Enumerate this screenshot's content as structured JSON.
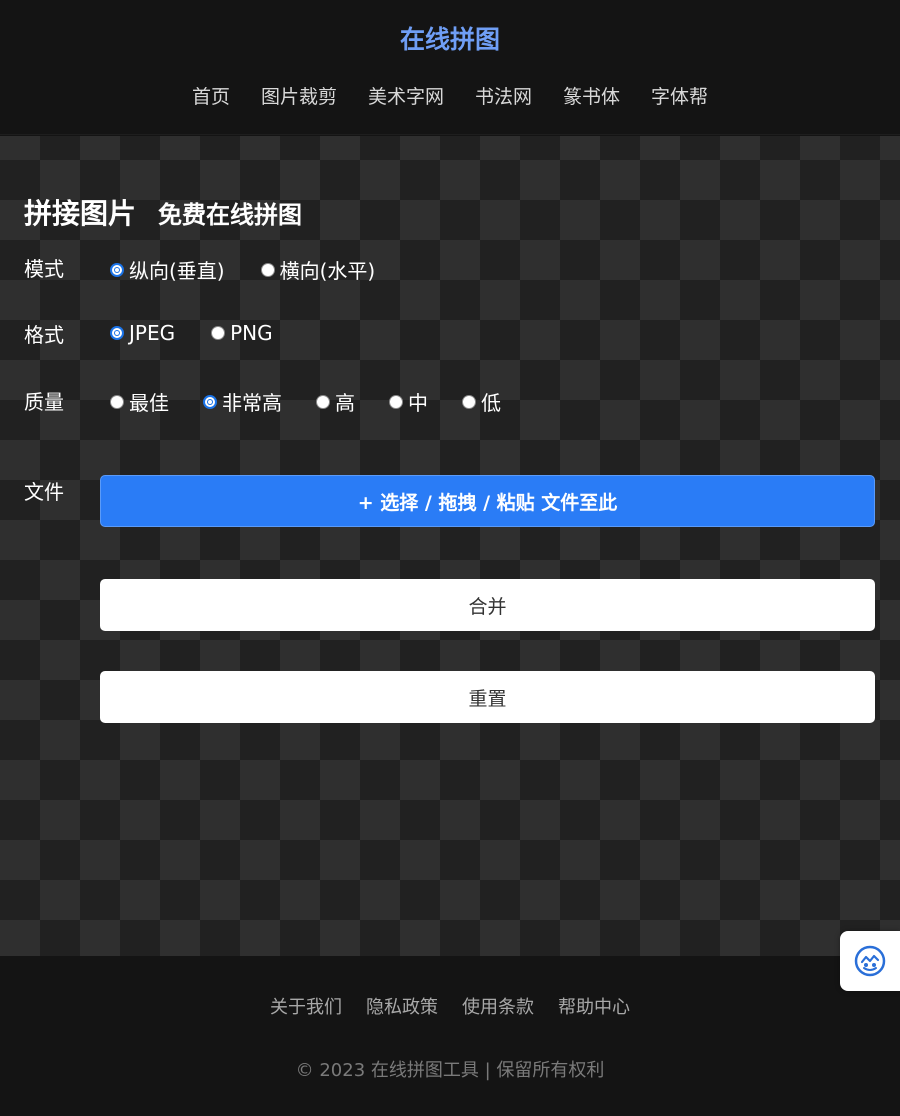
{
  "header": {
    "title": "在线拼图",
    "nav": [
      "首页",
      "图片裁剪",
      "美术字网",
      "书法网",
      "篆书体",
      "字体帮"
    ]
  },
  "main": {
    "heading": "拼接图片",
    "subheading": "免费在线拼图",
    "mode": {
      "label": "模式",
      "options": [
        "纵向(垂直)",
        "横向(水平)"
      ],
      "selected": "纵向(垂直)"
    },
    "format": {
      "label": "格式",
      "options": [
        "JPEG",
        "PNG"
      ],
      "selected": "JPEG"
    },
    "quality": {
      "label": "质量",
      "options": [
        "最佳",
        "非常高",
        "高",
        "中",
        "低"
      ],
      "selected": "非常高"
    },
    "file": {
      "label": "文件",
      "upload_label": "+ 选择 / 拖拽 / 粘贴 文件至此"
    },
    "merge_label": "合并",
    "reset_label": "重置"
  },
  "footer": {
    "links": [
      "关于我们",
      "隐私政策",
      "使用条款",
      "帮助中心"
    ],
    "copyright": "© 2023 在线拼图工具 | 保留所有权利"
  },
  "floating_button": {
    "icon": "assistant-icon"
  },
  "colors": {
    "accent": "#2a7cf6",
    "title": "#6f9ef5",
    "radio_checked": "#1a73e8"
  }
}
